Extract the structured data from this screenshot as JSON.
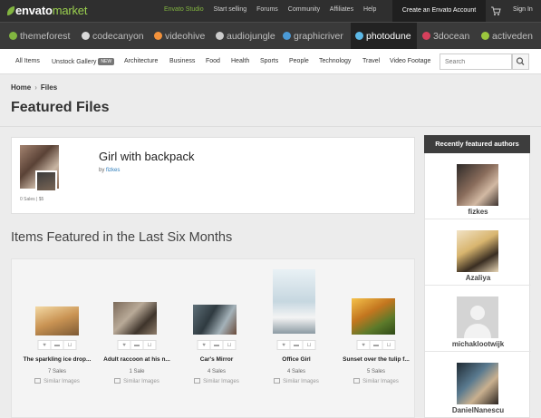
{
  "topbar": {
    "logo_envato": "envato",
    "logo_market": "market",
    "links": [
      "Envato Studio",
      "Start selling",
      "Forums",
      "Community",
      "Affiliates",
      "Help"
    ],
    "create_account": "Create an Envato Account",
    "cart_icon": "cart-icon",
    "sign_in": "Sign In"
  },
  "markets": [
    {
      "label": "themeforest",
      "color": "#82b540"
    },
    {
      "label": "codecanyon",
      "color": "#d9d9d9"
    },
    {
      "label": "videohive",
      "color": "#f3923b"
    },
    {
      "label": "audiojungle",
      "color": "#cccccc"
    },
    {
      "label": "graphicriver",
      "color": "#4b9ad6"
    },
    {
      "label": "photodune",
      "color": "#5cb8e6"
    },
    {
      "label": "3docean",
      "color": "#d6405c"
    },
    {
      "label": "activeden",
      "color": "#9bc63d"
    }
  ],
  "categories": {
    "items": [
      "All Items",
      "Unstock Gallery",
      "Architecture",
      "Business",
      "Food",
      "Health",
      "Sports",
      "People",
      "Technology",
      "Travel",
      "Video Footage"
    ],
    "new_badge": "NEW",
    "search_placeholder": "Search"
  },
  "breadcrumb": {
    "home": "Home",
    "sep": "›",
    "current": "Files"
  },
  "page_title": "Featured Files",
  "featured": {
    "title": "Girl with backpack",
    "by_prefix": "by",
    "author": "fizkes",
    "stats": "0 Sales | $5"
  },
  "section_title": "Items Featured in the Last Six Months",
  "items": [
    {
      "name": "The sparkling ice drop...",
      "sales": "7 Sales",
      "similar": "Similar Images"
    },
    {
      "name": "Adult raccoon at his n...",
      "sales": "1 Sale",
      "similar": "Similar Images"
    },
    {
      "name": "Car's Mirror",
      "sales": "4 Sales",
      "similar": "Similar Images"
    },
    {
      "name": "Office Girl",
      "sales": "4 Sales",
      "similar": "Similar Images"
    },
    {
      "name": "Sunset over the tulip f...",
      "sales": "5 Sales",
      "similar": "Similar Images"
    }
  ],
  "sidebar": {
    "heading": "Recently featured authors",
    "authors": [
      "fizkes",
      "Azaliya",
      "michaklootwijk",
      "DanielNanescu"
    ]
  }
}
